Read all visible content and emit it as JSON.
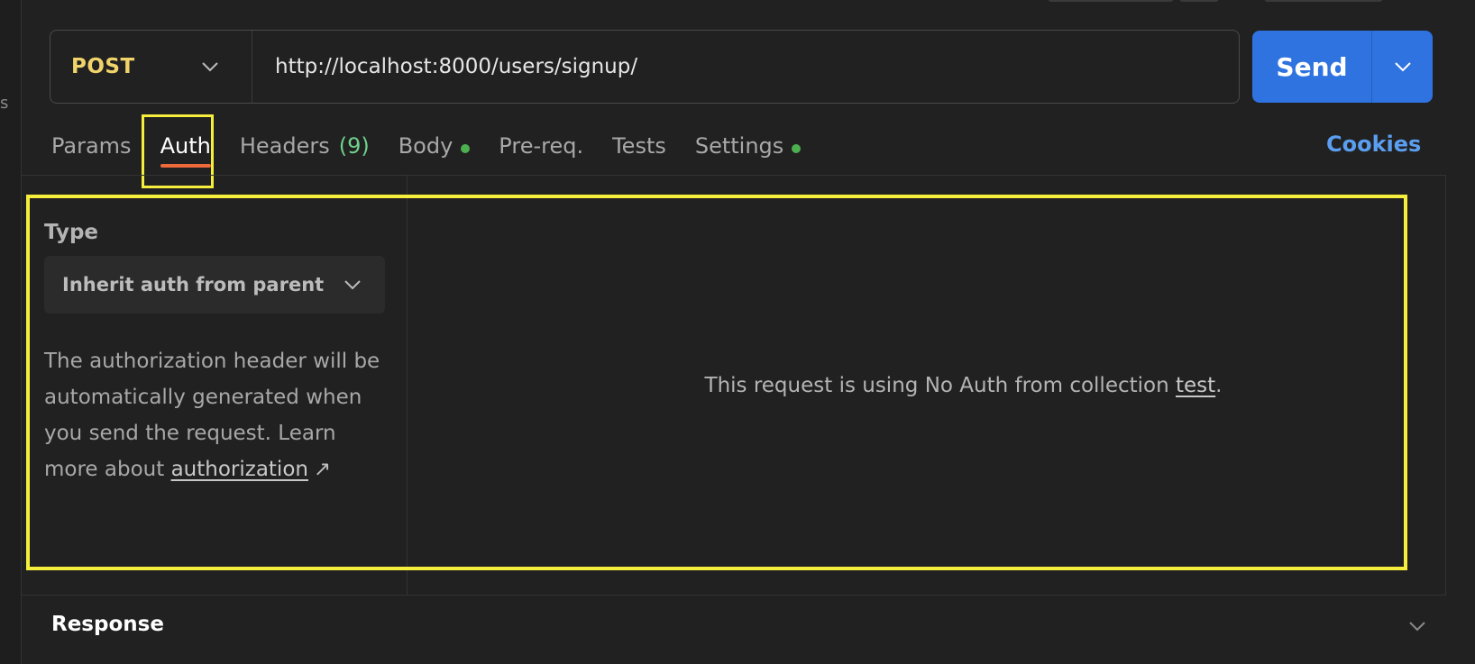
{
  "request": {
    "method": "POST",
    "url": "http://localhost:8000/users/signup/",
    "send_label": "Send"
  },
  "tabs": [
    {
      "label": "Params"
    },
    {
      "label": "Auth",
      "active": true
    },
    {
      "label": "Headers",
      "count": "(9)"
    },
    {
      "label": "Body",
      "dot": true
    },
    {
      "label": "Pre-req."
    },
    {
      "label": "Tests"
    },
    {
      "label": "Settings",
      "dot": true
    }
  ],
  "cookies_label": "Cookies",
  "auth": {
    "type_label": "Type",
    "type_value": "Inherit auth from parent",
    "help_text": "The authorization header will be automatically generated when you send the request. Learn more about",
    "help_link": "authorization",
    "help_link_icon": "↗",
    "no_auth_prefix": "This request is using No Auth from collection",
    "collection_name": "test",
    "no_auth_suffix": "."
  },
  "sidebar_cut_text": "s",
  "response_label": "Response",
  "colors": {
    "background": "#212121",
    "method": "#f0d46b",
    "send": "#2f73e0",
    "tab_underline": "#ee6a3b",
    "status_dot": "#4caf50",
    "header_count": "#6fd08a",
    "cookies": "#5b9ef0",
    "highlight": "#f5ee3c"
  }
}
